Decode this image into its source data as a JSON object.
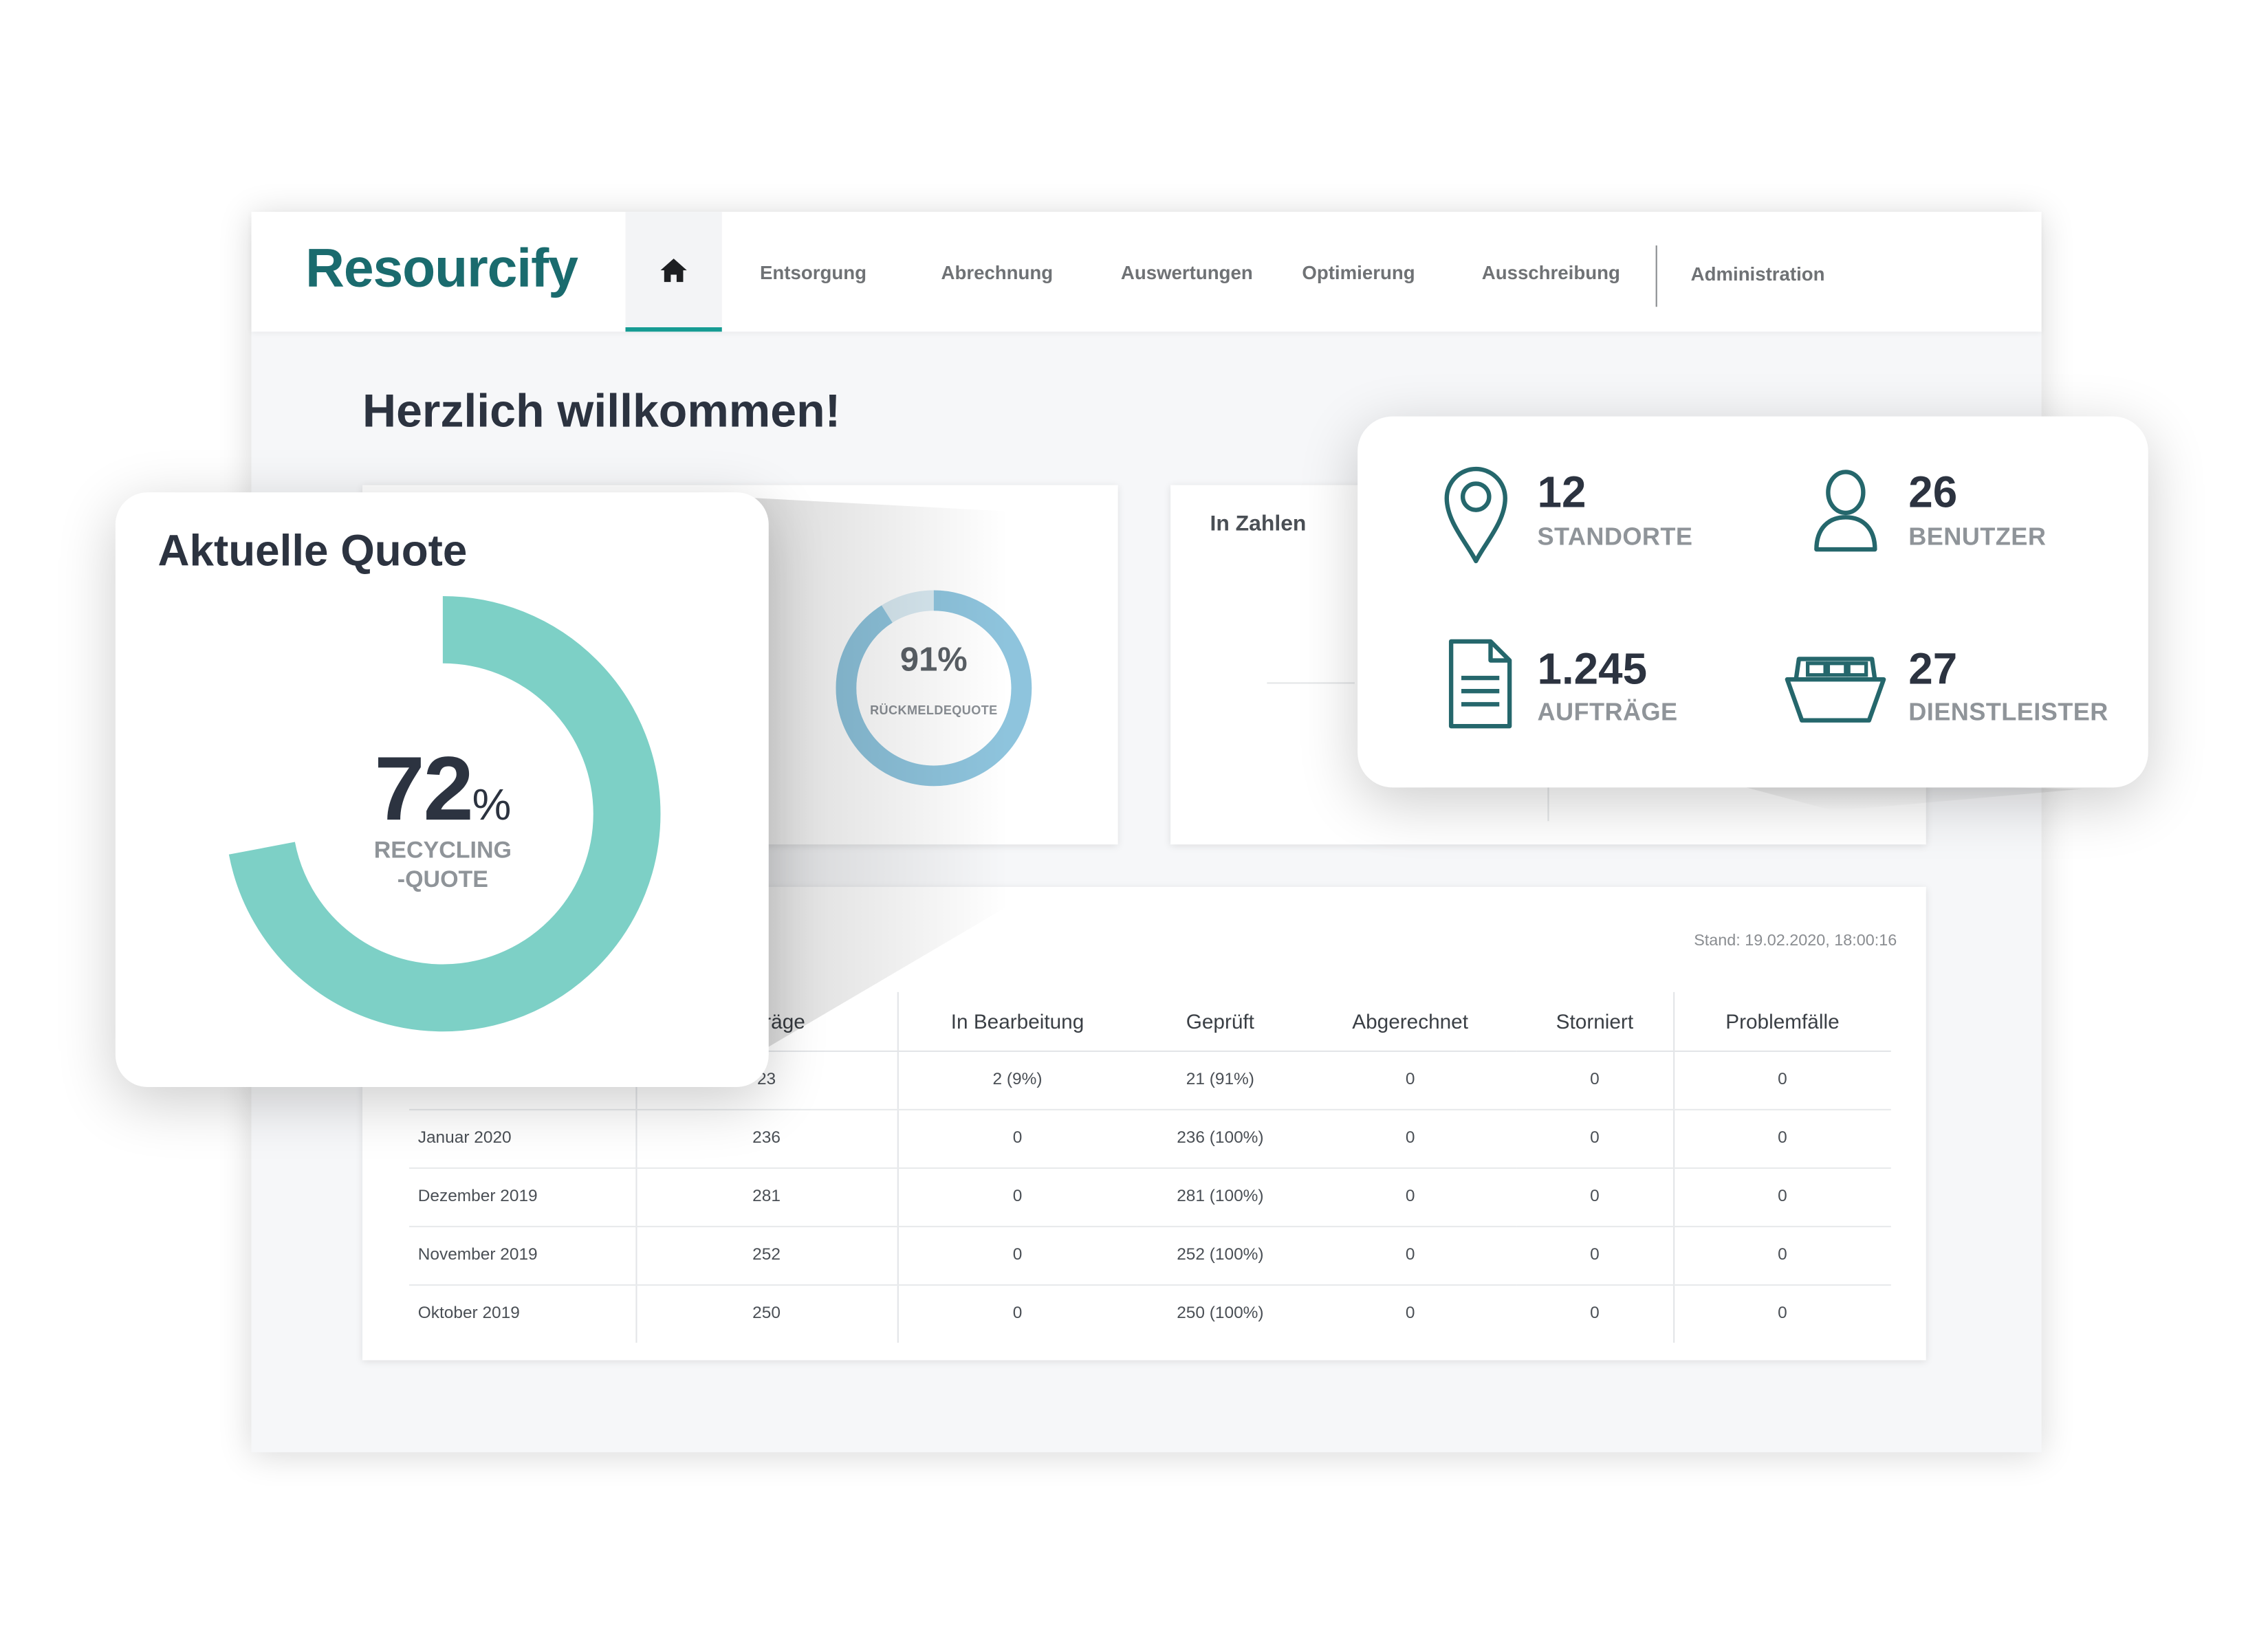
{
  "app": {
    "logo": "Resourcify"
  },
  "nav": {
    "home_icon": "home-icon",
    "items": [
      "Entsorgung",
      "Abrechnung",
      "Auswertungen",
      "Optimierung",
      "Ausschreibung",
      "Administration"
    ]
  },
  "welcome": "Herzlich willkommen!",
  "rueckmeldequote": {
    "value": "91%",
    "label": "RÜCKMELDEQUOTE",
    "fraction": 0.91
  },
  "in_zahlen": {
    "title": "In Zahlen"
  },
  "table": {
    "stand": "Stand: 19.02.2020, 18:00:16",
    "headers": [
      "",
      "Aufträge",
      "In Bearbeitung",
      "Geprüft",
      "Abgerechnet",
      "Storniert",
      "Problemfälle"
    ],
    "rows": [
      [
        "",
        "23",
        "2 (9%)",
        "21 (91%)",
        "0",
        "0",
        "0"
      ],
      [
        "Januar 2020",
        "236",
        "0",
        "236 (100%)",
        "0",
        "0",
        "0"
      ],
      [
        "Dezember 2019",
        "281",
        "0",
        "281 (100%)",
        "0",
        "0",
        "0"
      ],
      [
        "November 2019",
        "252",
        "0",
        "252 (100%)",
        "0",
        "0",
        "0"
      ],
      [
        "Oktober 2019",
        "250",
        "0",
        "250 (100%)",
        "0",
        "0",
        "0"
      ]
    ]
  },
  "quote_card": {
    "title": "Aktuelle Quote",
    "value": "72",
    "unit": "%",
    "label_line1": "RECYCLING",
    "label_line2": "-QUOTE",
    "fraction": 0.72
  },
  "stats": {
    "standorte": {
      "value": "12",
      "label": "STANDORTE",
      "icon": "location-pin-icon"
    },
    "benutzer": {
      "value": "26",
      "label": "BENUTZER",
      "icon": "user-icon"
    },
    "auftraege": {
      "value": "1.245",
      "label": "AUFTRÄGE",
      "icon": "document-icon"
    },
    "dienstleister": {
      "value": "27",
      "label": "DIENSTLEISTER",
      "icon": "container-icon"
    }
  },
  "colors": {
    "brand": "#1a6b6e",
    "accent": "#159b93",
    "ring_green": "#7dd0c6",
    "ring_blue": "#8ec4dd",
    "icon_teal": "#25676c"
  }
}
